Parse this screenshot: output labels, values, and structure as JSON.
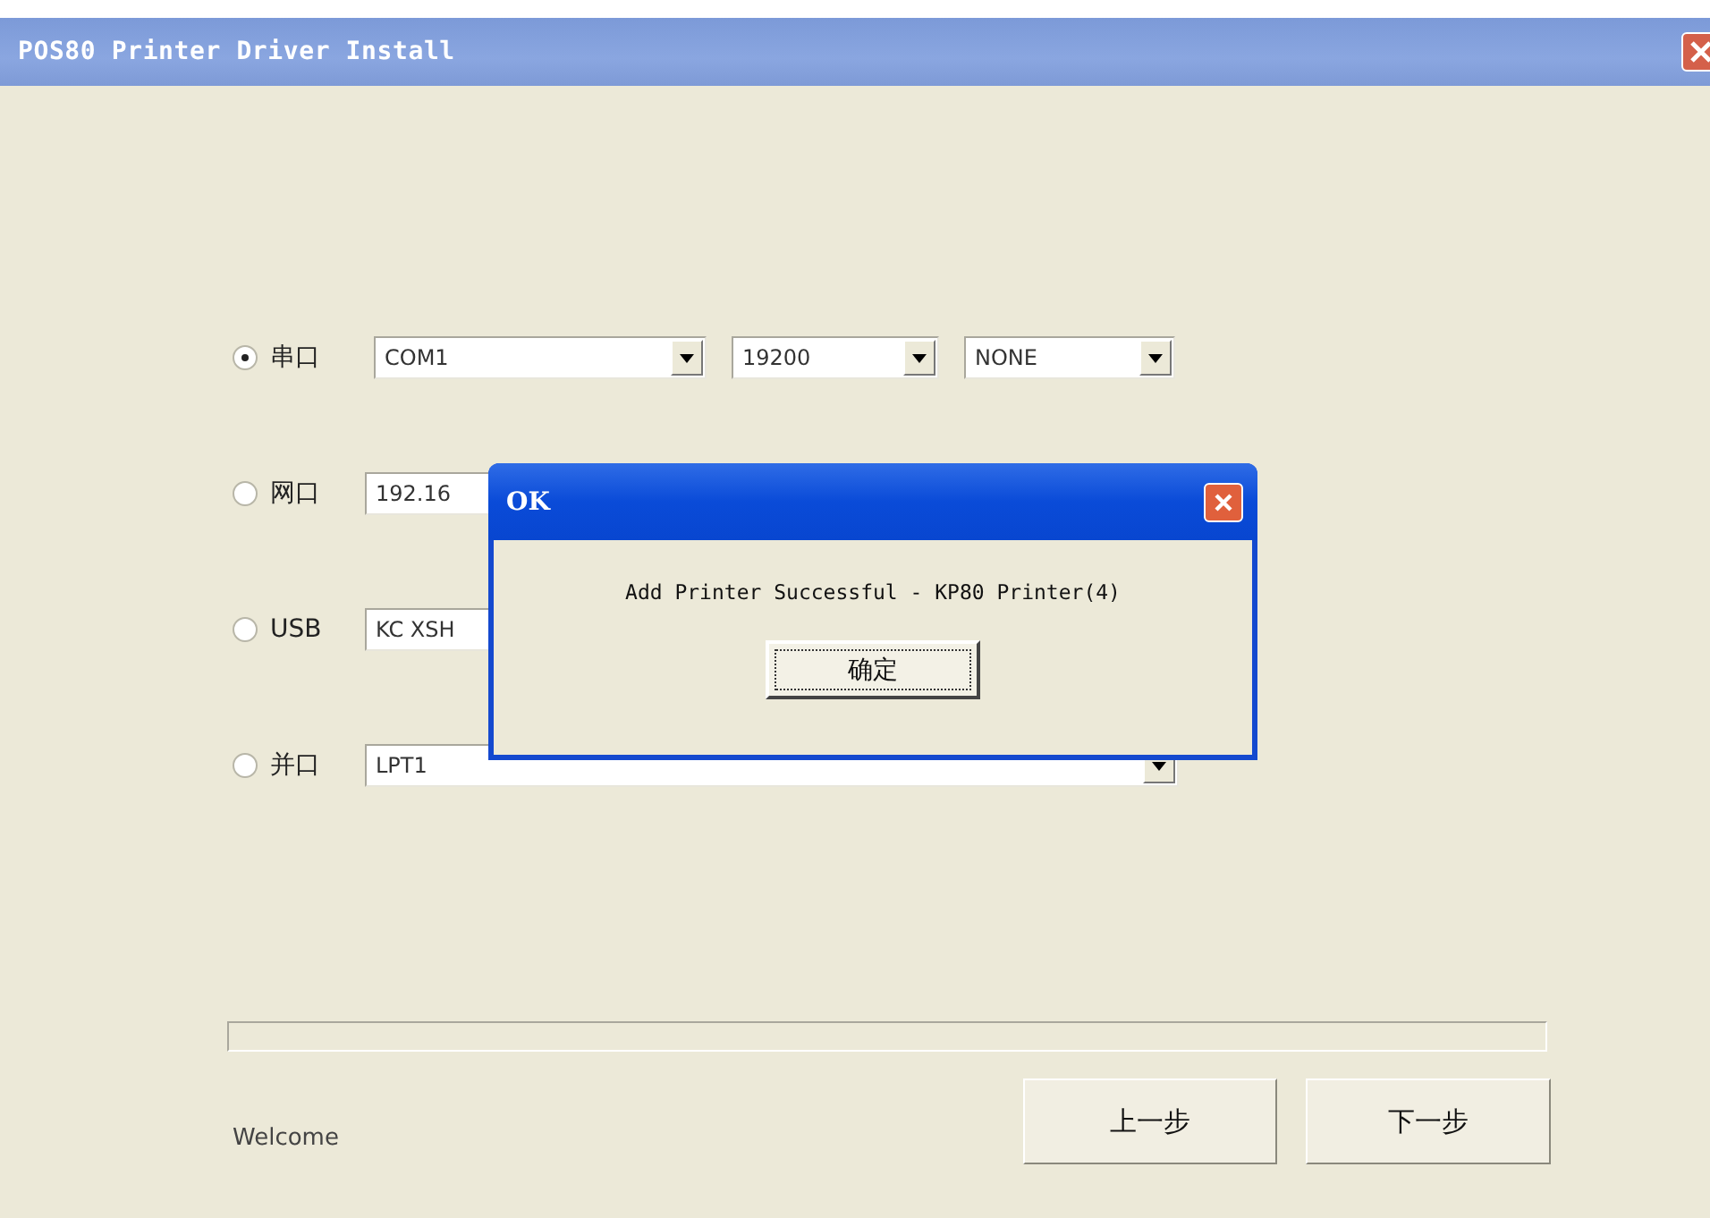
{
  "window": {
    "title": "POS80 Printer Driver Install"
  },
  "ports": [
    {
      "label": "串口",
      "selected": true,
      "fields": [
        {
          "value": "COM1",
          "kind": "combo"
        },
        {
          "value": "19200",
          "kind": "combo"
        },
        {
          "value": "NONE",
          "kind": "combo"
        }
      ]
    },
    {
      "label": "网口",
      "selected": false,
      "fields": [
        {
          "value": "192.16",
          "kind": "text"
        }
      ]
    },
    {
      "label": "USB",
      "selected": false,
      "fields": [
        {
          "value": "KC XSH",
          "kind": "text"
        }
      ]
    },
    {
      "label": "并口",
      "selected": false,
      "fields": [
        {
          "value": "LPT1",
          "kind": "combo"
        }
      ]
    }
  ],
  "progress": {
    "level": 0
  },
  "status": "Welcome",
  "buttons": [
    "上一步",
    "下一步"
  ],
  "dialog": {
    "title": "OK",
    "message": "Add Printer Successful - KP80 Printer(4)",
    "button": "确定"
  }
}
